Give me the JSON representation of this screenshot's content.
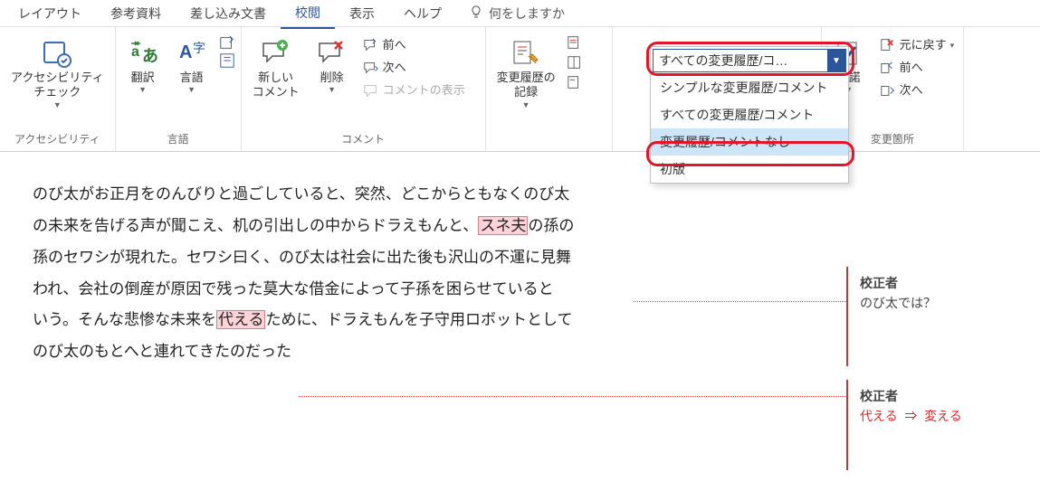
{
  "tabs": {
    "layout": "レイアウト",
    "references": "参考資料",
    "mailings": "差し込み文書",
    "review": "校閲",
    "view": "表示",
    "help": "ヘルプ",
    "tell_me": "何をしますか"
  },
  "ribbon": {
    "accessibility": {
      "btn": "アクセシビリティ\nチェック",
      "group": "アクセシビリティ"
    },
    "language": {
      "translate": "翻訳",
      "lang": "言語",
      "group": "言語"
    },
    "comments": {
      "new": "新しい\nコメント",
      "delete": "削除",
      "prev": "前へ",
      "next": "次へ",
      "show": "コメントの表示",
      "group": "コメント"
    },
    "tracking": {
      "track": "変更履歴の\n記録",
      "combo_value": "すべての変更履歴/コ…",
      "options": {
        "simple": "シンプルな変更履歴/コメント",
        "all": "すべての変更履歴/コメント",
        "none": "変更履歴/コメントなし",
        "original": "初版"
      }
    },
    "changes": {
      "accept": "承諾",
      "revert": "元に戻す",
      "prev": "前へ",
      "next": "次へ",
      "group": "変更箇所"
    }
  },
  "document": {
    "line1_a": "のび太がお正月をのんびりと過ごしていると、突然、どこからともなくのび太",
    "line2_a": "の未来を告げる声が聞こえ、机の引出しの中からドラえもんと、",
    "line2_hl": "スネ夫",
    "line2_b": "の孫の",
    "line3": "孫のセワシが現れた。セワシ曰く、のび太は社会に出た後も沢山の不運に見舞",
    "line4": "われ、会社の倒産が原因で残った莫大な借金によって子孫を困らせていると",
    "line5_a": "いう。そんな悲惨な未来を",
    "line5_hl": "代える",
    "line5_b": "ために、ドラえもんを子守用ロボットとして",
    "line6": "のび太のもとへと連れてきたのだった"
  },
  "comments": {
    "c1": {
      "author": "校正者",
      "body": "のび太では？"
    },
    "c2": {
      "author": "校正者",
      "from": "代える",
      "arrow": "⇒",
      "to": "変える"
    }
  }
}
